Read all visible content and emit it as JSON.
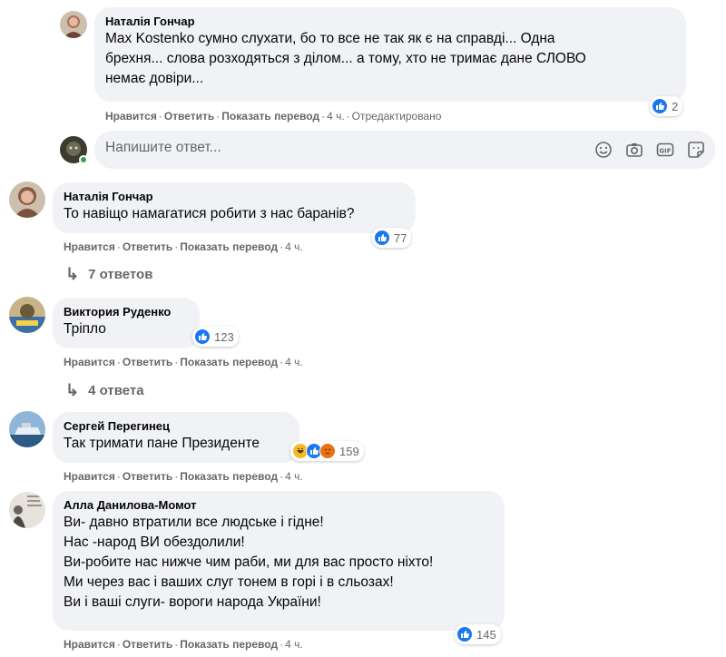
{
  "comments": [
    {
      "author": "Наталія Гончар",
      "text_lines": [
        "Max Kostenko сумно слухати, бо то все не так як є на справді... Одна",
        "брехня... слова розходяться з ділом... а тому, хто не тримає дане СЛОВО",
        "немає довіри..."
      ],
      "reaction_count": "2",
      "actions": {
        "like": "Нравится",
        "reply": "Ответить",
        "translate": "Показать перевод",
        "time": "4 ч.",
        "edited": "Отредактировано"
      }
    },
    {
      "author": "Наталія Гончар",
      "text_lines": [
        "То навіщо намагатися робити з нас баранів?"
      ],
      "reaction_count": "77",
      "actions": {
        "like": "Нравится",
        "reply": "Ответить",
        "translate": "Показать перевод",
        "time": "4 ч."
      },
      "replies": "7 ответов"
    },
    {
      "author": "Виктория Руденко",
      "text_lines": [
        "Тріпло"
      ],
      "reaction_count": "123",
      "actions": {
        "like": "Нравится",
        "reply": "Ответить",
        "translate": "Показать перевод",
        "time": "4 ч."
      },
      "replies": "4 ответа"
    },
    {
      "author": "Сергей Перегинец",
      "text_lines": [
        "Так тримати пане Президенте"
      ],
      "reaction_count": "159",
      "actions": {
        "like": "Нравится",
        "reply": "Ответить",
        "translate": "Показать перевод",
        "time": "4 ч."
      }
    },
    {
      "author": "Алла Данилова-Момот",
      "text_lines": [
        "Ви- давно втратили все людське і гідне!",
        "Нас -народ ВИ обездолили!",
        "Ви-робите нас нижче чим раби, ми для вас просто ніхто!",
        "Ми через вас і ваших слуг тонем в горі і в сльозах!",
        "Ви і ваші слуги- вороги народа України!"
      ],
      "reaction_count": "145",
      "actions": {
        "like": "Нравится",
        "reply": "Ответить",
        "translate": "Показать перевод",
        "time": "4 ч."
      }
    }
  ],
  "reply_box": {
    "placeholder": "Напишите ответ..."
  },
  "icons": [
    "like-icon",
    "haha-icon",
    "sad-icon",
    "angry-icon",
    "emoji-icon",
    "camera-icon",
    "gif-icon",
    "sticker-icon",
    "reply-arrow-icon"
  ],
  "colors": {
    "bubble": "#f0f2f5",
    "meta_text": "#65676b",
    "like_blue": "#1877f2",
    "online_green": "#31a24c"
  }
}
